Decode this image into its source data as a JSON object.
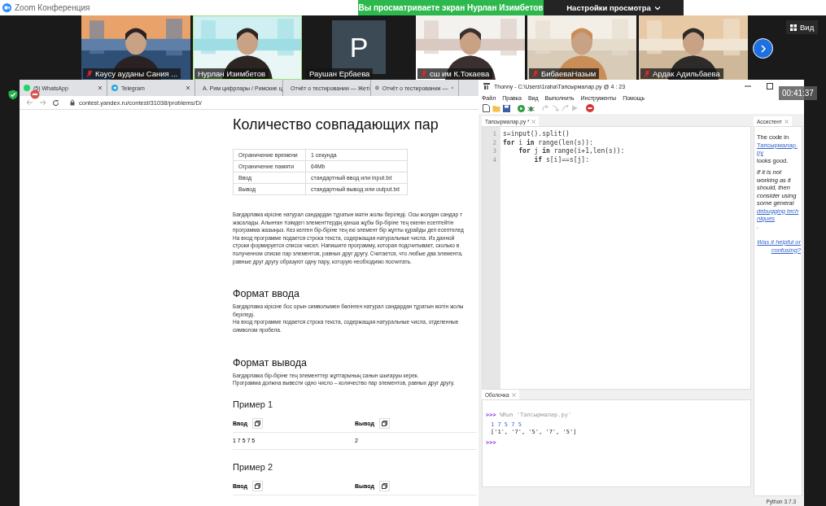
{
  "window": {
    "title": "Zoom Конференция"
  },
  "share_banner": {
    "text": "Вы просматриваете экран Нурлан Изимбетов"
  },
  "view_options": {
    "label": "Настройки просмотра"
  },
  "view_button": {
    "label": "Вид"
  },
  "participants": [
    {
      "kind": "video",
      "name": "Кәусу ауданы Сания ...",
      "muted": true,
      "speaking": false
    },
    {
      "kind": "video",
      "name": "Нурлан Изимбетов",
      "muted": false,
      "speaking": true
    },
    {
      "kind": "avatar",
      "initial": "P",
      "name": "Раушан Ербаева",
      "muted": false,
      "speaking": false
    },
    {
      "kind": "video",
      "name": "сш им К.Токаева",
      "muted": true,
      "speaking": false
    },
    {
      "kind": "video",
      "name": "БибаеваНазым",
      "muted": true,
      "speaking": false
    },
    {
      "kind": "video",
      "name": "Ардак Адильбаева",
      "muted": true,
      "speaking": false
    }
  ],
  "timer": "00:41:37",
  "browser": {
    "tabs": [
      {
        "kind": "chat",
        "title": "(5) WhatsApp"
      },
      {
        "kind": "messenger",
        "title": "Telegram"
      },
      {
        "kind": "doc",
        "title": "А. Рим цифрлары / Римские ц"
      },
      {
        "kind": "doc",
        "title": "Отчёт о тестировании — Жеті"
      },
      {
        "kind": "globe",
        "title": "Отчёт о тестировании —"
      }
    ],
    "url": "contest.yandex.ru/contest/31038/problems/D/",
    "page": {
      "title": "Количество совпадающих пар",
      "limits": [
        {
          "name": "Ограничение времени",
          "value": "1 секунда"
        },
        {
          "name": "Ограничение памяти",
          "value": "64Mb"
        },
        {
          "name": "Ввод",
          "value": "стандартный ввод или input.txt"
        },
        {
          "name": "Вывод",
          "value": "стандартный вывод или output.txt"
        }
      ],
      "statement": "Бағдарлама кірісіне натурал сандардан тұратын мәтін жолы беріледі. Осы жолдан сандар т\nжасалады. Алынған тізімдегі элементтердің қанша жұбы бір-біріне тең екенін есептейтін\nпрограмма жазыңыз. Кез келген бір-біріне тең екі элемент бір жұпты құрайды деп есептелед\nНа вход программе подается строка текста, содержащая натуральные числа. Из данной\nстроки формируется список чисел. Напишите программу, которая подсчитывает, сколько в\nполученном списке пар элементов, равных друг другу. Считается, что любые два элемента,\nравные друг другу образуют одну пару, которую необходимо посчитать.",
      "sections": [
        {
          "heading": "Формат ввода",
          "text": "Бағдарлама кірісіне бос орын символымен бөлінген натурал сандардан тұратын мәтін жолы\nберіледі.\nНа вход программе подается строка текста, содержащая натуральные числа, отделенные\nсимволом пробела."
        },
        {
          "heading": "Формат вывода",
          "text": "Бағдарлама бір-біріне тең элементтер жұптарының санын шығаруы керек.\nПрограмма должна вывести одно число – количество пар элементов, равных друг другу."
        }
      ],
      "examples": [
        {
          "title": "Пример 1",
          "input_label": "Ввод",
          "output_label": "Вывод",
          "input": "1 7 5 7 5",
          "output": "2"
        },
        {
          "title": "Пример 2",
          "input_label": "Ввод",
          "output_label": "Вывод"
        }
      ]
    }
  },
  "thonny": {
    "title": "Thonny  -  C:\\Users\\1raha\\Тапсырмалар.py  @  4 : 23",
    "menu": [
      "Файл",
      "Правка",
      "Вид",
      "Выполнить",
      "Инструменты",
      "Помощь"
    ],
    "toolbar": [
      {
        "kind": "new",
        "disabled": false
      },
      {
        "kind": "open",
        "disabled": false
      },
      {
        "kind": "save",
        "disabled": false
      },
      {
        "kind": "run",
        "disabled": false
      },
      {
        "kind": "debug",
        "disabled": false
      },
      {
        "kind": "step_over",
        "disabled": true
      },
      {
        "kind": "step_into",
        "disabled": true
      },
      {
        "kind": "step_out",
        "disabled": true
      },
      {
        "kind": "resume",
        "disabled": true
      },
      {
        "kind": "stop",
        "disabled": false
      }
    ],
    "editor_tab": "Тапсырмалар.py *",
    "code": [
      {
        "number": "1",
        "text": "s=input().split()"
      },
      {
        "number": "2",
        "text": "**for** i **in** range(len(s)):"
      },
      {
        "number": "3",
        "text": "    **for** j **in** range(i+1,len(s)):"
      },
      {
        "number": "4",
        "text": "        **if** s[i]==s[j]:"
      }
    ],
    "shell_tab": "Оболочка",
    "shell": [
      {
        "kind": "command",
        "prompt": ">>>",
        "text": "%Run 'Тапсырмалар.py'"
      },
      {
        "kind": "input",
        "text": "1 7 5 7 5"
      },
      {
        "kind": "output",
        "text": "['1', '7', '5', '7', '5']"
      },
      {
        "kind": "command",
        "prompt": ">>>"
      }
    ],
    "assistant_tab": "Ассистент",
    "assistant": [
      {
        "kind": "plain",
        "before": "The code in",
        "link": "Тапсырмалар.py",
        "after": "looks good."
      },
      {
        "kind": "italic",
        "before": "If it is not working as it should, then consider using some general",
        "link": "debugging techniques",
        "after": "."
      },
      {
        "kind": "link_only",
        "link": "Was it helpful or confusing?"
      }
    ],
    "status": "Python 3.7.3"
  }
}
